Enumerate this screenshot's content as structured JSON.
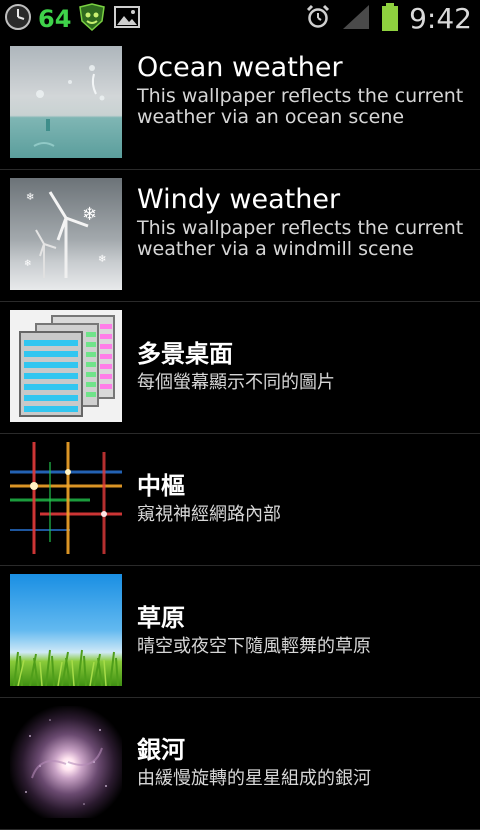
{
  "status_bar": {
    "clock_icon": "analog-clock-icon",
    "number": "64",
    "badge_icon": "shield-badge-icon",
    "image_icon": "picture-icon",
    "alarm_icon": "alarm-clock-icon",
    "signal_icon": "signal-icon",
    "battery_icon": "battery-icon",
    "time": "9:42"
  },
  "wallpapers": [
    {
      "title": "Ocean weather",
      "description": "This wallpaper reflects the current weather via an ocean scene",
      "thumb_icon": "ocean-thumbnail"
    },
    {
      "title": "Windy weather",
      "description": "This wallpaper reflects the current weather via a windmill scene",
      "thumb_icon": "windmill-thumbnail"
    },
    {
      "title": "多景桌面",
      "description": "每個螢幕顯示不同的圖片",
      "thumb_icon": "multi-page-thumbnail"
    },
    {
      "title": "中樞",
      "description": "窺視神經網路內部",
      "thumb_icon": "neural-grid-thumbnail"
    },
    {
      "title": "草原",
      "description": "晴空或夜空下隨風輕舞的草原",
      "thumb_icon": "grassland-thumbnail"
    },
    {
      "title": "銀河",
      "description": "由緩慢旋轉的星星組成的銀河",
      "thumb_icon": "galaxy-thumbnail"
    }
  ],
  "colors": {
    "background": "#000000",
    "accent_green": "#3fd24a",
    "divider": "#2a2a2a"
  }
}
